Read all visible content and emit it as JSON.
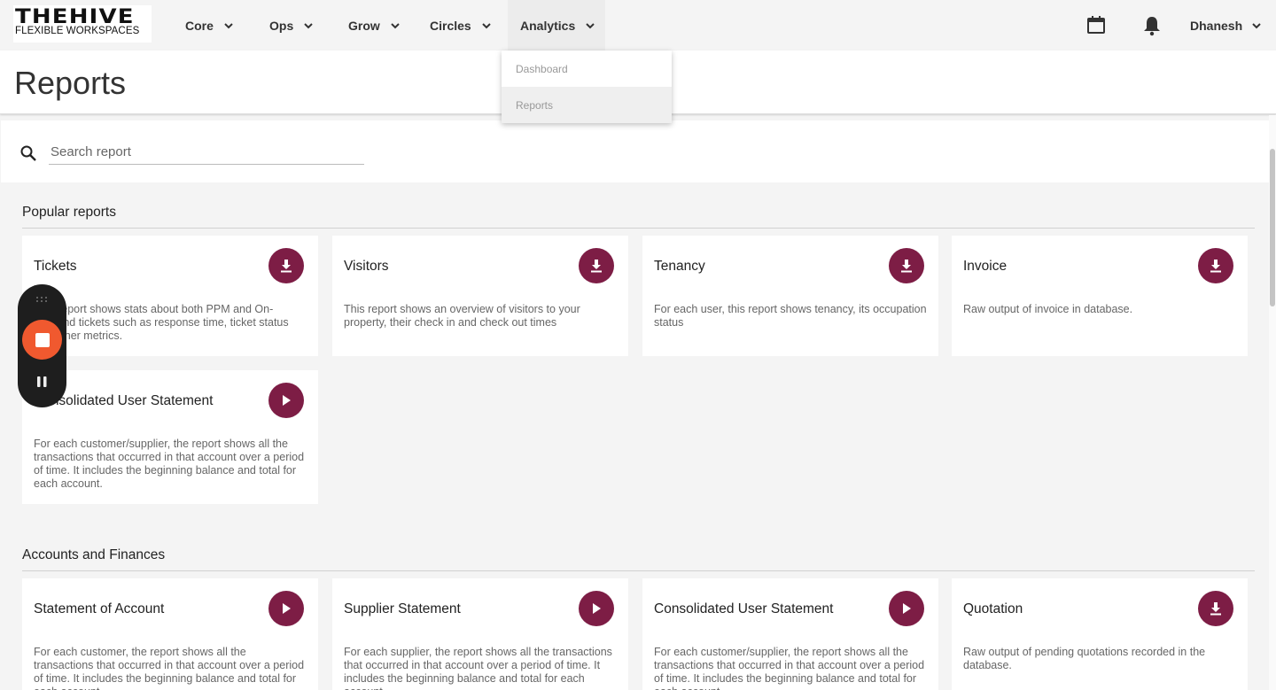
{
  "brand": {
    "logo_main": "THEHIVE",
    "logo_sub": "FLEXIBLE WORKSPACES"
  },
  "nav": {
    "items": [
      {
        "label": "Core"
      },
      {
        "label": "Ops"
      },
      {
        "label": "Grow"
      },
      {
        "label": "Circles"
      },
      {
        "label": "Analytics"
      }
    ],
    "active": "Analytics",
    "user": "Dhanesh",
    "icons": [
      "calendar-icon",
      "bell-icon"
    ]
  },
  "analytics_menu": {
    "items": [
      {
        "label": "Dashboard"
      },
      {
        "label": "Reports"
      }
    ],
    "selected": "Reports"
  },
  "page": {
    "title": "Reports"
  },
  "search": {
    "placeholder": "Search report"
  },
  "sections": [
    {
      "title": "Popular reports",
      "cards": [
        {
          "title": "Tickets",
          "desc": "This report shows stats about both PPM and On-Demand tickets such as response time, ticket status and other metrics.",
          "action": "download-icon"
        },
        {
          "title": "Visitors",
          "desc": "This report shows an overview of visitors to your property, their check in and check out times",
          "action": "download-icon"
        },
        {
          "title": "Tenancy",
          "desc": "For each user, this report shows tenancy, its occupation status",
          "action": "download-icon"
        },
        {
          "title": "Invoice",
          "desc": "Raw output of invoice in database.",
          "action": "download-icon"
        },
        {
          "title": "Consolidated User Statement",
          "desc": "For each customer/supplier, the report shows all the transactions that occurred in that account over a period of time. It includes the beginning balance and total for each account.",
          "action": "play-icon"
        }
      ]
    },
    {
      "title": "Accounts and Finances",
      "cards": [
        {
          "title": "Statement of Account",
          "desc": "For each customer, the report shows all the transactions that occurred in that account over a period of time. It includes the beginning balance and total for each account.",
          "action": "play-icon"
        },
        {
          "title": "Supplier Statement",
          "desc": "For each supplier, the report shows all the transactions that occurred in that account over a period of time. It includes the beginning balance and total for each account.",
          "action": "play-icon"
        },
        {
          "title": "Consolidated User Statement",
          "desc": "For each customer/supplier, the report shows all the transactions that occurred in that account over a period of time. It includes the beginning balance and total for each account.",
          "action": "play-icon"
        },
        {
          "title": "Quotation",
          "desc": "Raw output of pending quotations recorded in the database.",
          "action": "download-icon"
        }
      ]
    }
  ],
  "colors": {
    "accent": "#7d1d45",
    "record": "#f0592f",
    "background": "#f4f4f4"
  }
}
